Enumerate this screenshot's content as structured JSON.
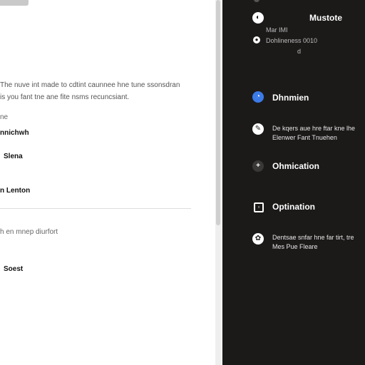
{
  "left": {
    "description": [
      "The nuve int made to cdtint caunnee hne tune ssonsdran",
      "is you fant tne ane fite nsms recuncsiant."
    ],
    "section_label": "ne",
    "items": [
      {
        "label": "nnichwh",
        "kind": "bold"
      },
      {
        "label": "Slena",
        "kind": "bold"
      },
      {
        "label": "n Lenton",
        "kind": "bold"
      },
      {
        "label": "h en mnep diurfort",
        "kind": "light"
      },
      {
        "label": "Soest",
        "kind": "bold"
      }
    ]
  },
  "right": {
    "header": {
      "title": "Mustote",
      "meta_line1": "Mar IMI",
      "meta_line2": "Dohlineness 0010",
      "meta_line3": "d"
    },
    "items": [
      {
        "icon": "blue-circle-icon",
        "title": "Dhnmien",
        "subtitle": []
      },
      {
        "icon": "brush-icon",
        "title": "",
        "subtitle": [
          "De kqers aue hre ftar kne lhe",
          "Elenwer Fant Tnuehen"
        ]
      },
      {
        "icon": "minus-plus-icon",
        "title": "Ohmication",
        "subtitle": []
      },
      {
        "icon": "square-icon",
        "title": "Optination",
        "subtitle": []
      },
      {
        "icon": "palette-icon",
        "title": "",
        "subtitle": [
          "Dentsae snfar hne far tirt, tre",
          "Mes Pue Fleare"
        ]
      }
    ]
  },
  "colors": {
    "dark_bg": "#1c1a19",
    "accent_blue": "#3b7be8",
    "left_bg": "#ffffff"
  }
}
